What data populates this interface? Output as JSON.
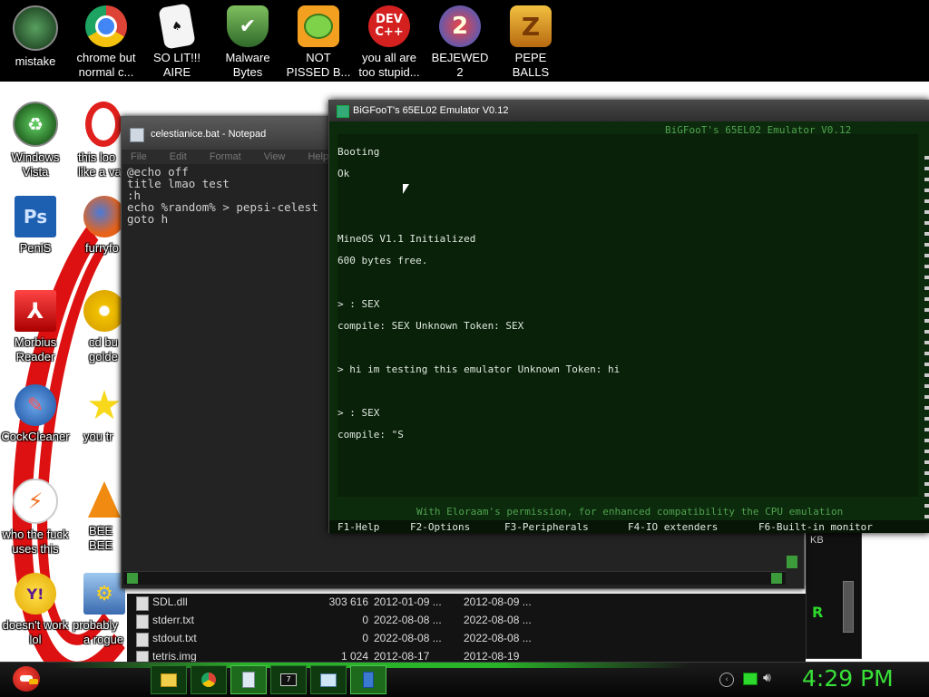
{
  "desktop": {
    "top_icons": [
      {
        "label_1": "mistake",
        "label_2": "",
        "icon": "circle-icon",
        "color": "#2d7a35"
      },
      {
        "label_1": "chrome but",
        "label_2": "normal c...",
        "icon": "chrome-icon",
        "color": "#dd4437"
      },
      {
        "label_1": "SO LIT!!!",
        "label_2": "AIRE",
        "icon": "ace-card-icon",
        "color": "#f4f4f4"
      },
      {
        "label_1": "Malware",
        "label_2": "Bytes",
        "icon": "shield-check-icon",
        "color": "#4a8a3a"
      },
      {
        "label_1": "NOT",
        "label_2": "PISSED B...",
        "icon": "angry-pig-icon",
        "color": "#f3a020"
      },
      {
        "label_1": "you all are",
        "label_2": "too stupid...",
        "icon": "devcpp-icon",
        "color": "#d52020",
        "badge_1": "DEV",
        "badge_2": "C++"
      },
      {
        "label_1": "BEJEWED",
        "label_2": "2",
        "icon": "bejeweled-icon",
        "color": "#2a62d8",
        "badge_1": "2"
      },
      {
        "label_1": "PEPE",
        "label_2": "BALLS",
        "icon": "zuma-icon",
        "color": "#e39a1a",
        "badge_1": "Z"
      }
    ],
    "left_icons": [
      {
        "label_1": "Windows",
        "label_2": "Vista",
        "icon": "recycle-bin-icon"
      },
      {
        "label_1": "PeniS",
        "label_2": "",
        "icon": "photoshop-icon",
        "badge_1": "Ps"
      },
      {
        "label_1": "Morbius",
        "label_2": "Reader",
        "icon": "pdf-reader-icon"
      },
      {
        "label_1": "CockCleaner",
        "label_2": "",
        "icon": "broom-icon"
      },
      {
        "label_1": "who the fuck",
        "label_2": "uses this",
        "icon": "lightning-icon"
      },
      {
        "label_1": "doesn't work",
        "label_2": "lol",
        "icon": "yahoo-icon",
        "badge_1": "Y!"
      }
    ],
    "second_col_icons": [
      {
        "label_1": "this loo",
        "label_2": "like a va",
        "icon": "opera-icon"
      },
      {
        "label_1": "furryfo",
        "label_2": "",
        "icon": "firefox-icon"
      },
      {
        "label_1": "cd bu",
        "label_2": "golde",
        "icon": "disc-icon"
      },
      {
        "label_1": "you tr",
        "label_2": "",
        "icon": "star-icon"
      },
      {
        "label_1": "BEE",
        "label_2": "BEE",
        "icon": "vlc-cone-icon"
      },
      {
        "label_1": "probably",
        "label_2": "a rogue",
        "icon": "gear-setup-icon"
      }
    ]
  },
  "notepad": {
    "title": "celestianice.bat - Notepad",
    "menu": [
      "File",
      "Edit",
      "Format",
      "View",
      "Help"
    ],
    "lines": [
      "@echo off",
      "title lmao test",
      ":h",
      "echo %random% > pepsi-celest",
      "goto h"
    ]
  },
  "explorer": {
    "rows": [
      {
        "name": "SDL.dll",
        "size": "303 616",
        "created": "2012-01-09 ...",
        "modified": "2012-08-09 ..."
      },
      {
        "name": "stderr.txt",
        "size": "0",
        "created": "2022-08-08 ...",
        "modified": "2022-08-08 ..."
      },
      {
        "name": "stdout.txt",
        "size": "0",
        "created": "2022-08-08 ...",
        "modified": "2022-08-08 ..."
      },
      {
        "name": "tetris.img",
        "size": "1 024",
        "created": "2012-08-17",
        "modified": "2012-08-19"
      }
    ]
  },
  "emulator": {
    "title": "BiGFooT's 65EL02 Emulator V0.12",
    "header": "BiGFooT's 65EL02 Emulator V0.12",
    "console": [
      "Booting",
      "Ok",
      "",
      "",
      "MineOS V1.1 Initialized",
      "600 bytes free.",
      "",
      "> : SEX",
      "compile: SEX Unknown Token: SEX",
      "",
      "> hi im testing this emulator Unknown Token: hi",
      "",
      "> : SEX",
      "compile: \"S"
    ],
    "footer": "With Eloraam's permission, for enhanced compatibility the CPU emulation",
    "fkeys": [
      "F1-Help",
      "F2-Options",
      "F3-Peripherals",
      "F4-IO extenders",
      "F6-Built-in monitor"
    ]
  },
  "taskbar": {
    "clock": "4:29 PM",
    "buttons": [
      "folder-icon",
      "chrome-icon",
      "notepad-icon",
      "console-icon",
      "window-icon",
      "book-icon"
    ],
    "accent": "#2cd92c"
  }
}
